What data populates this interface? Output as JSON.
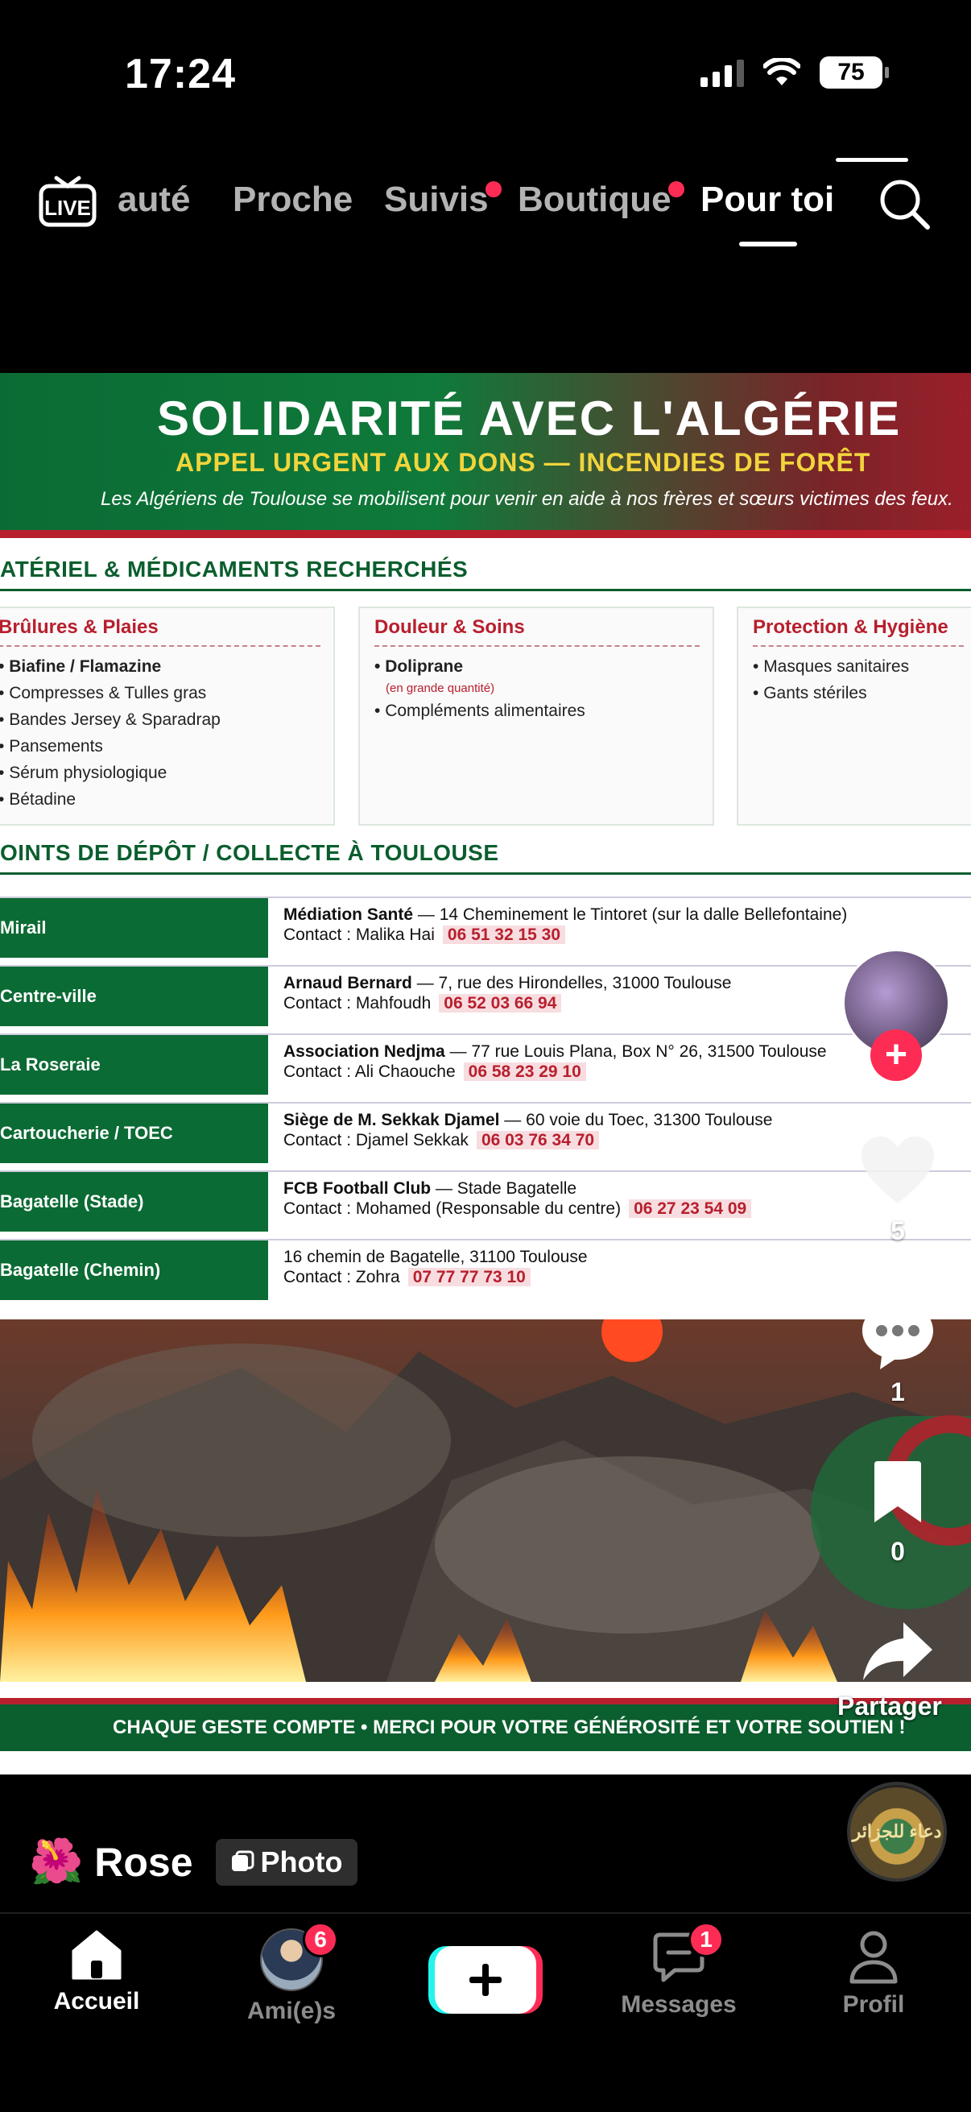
{
  "status_bar": {
    "time": "17:24",
    "battery": "75"
  },
  "top_nav": {
    "tabs": [
      {
        "label": "auté",
        "has_dot": false
      },
      {
        "label": "Proche",
        "has_dot": false
      },
      {
        "label": "Suivis",
        "has_dot": true
      },
      {
        "label": "Boutique",
        "has_dot": true
      },
      {
        "label": "Pour toi",
        "has_dot": false,
        "active": true
      }
    ],
    "live_label": "LIVE"
  },
  "poster": {
    "title": "SOLIDARITÉ AVEC L'ALGÉRIE",
    "subtitle": "APPEL URGENT AUX DONS — INCENDIES DE FORÊT",
    "intro": "Les Algériens de Toulouse se mobilisent pour venir en aide à nos frères et sœurs victimes des feux.",
    "materials_title": "ATÉRIEL & MÉDICAMENTS RECHERCHÉS",
    "categories": [
      {
        "title": "Brûlures & Plaies",
        "items": [
          "Biafine / Flamazine",
          "Compresses & Tulles gras",
          "Bandes Jersey & Sparadrap",
          "Pansements",
          "Sérum physiologique",
          "Bétadine"
        ]
      },
      {
        "title": "Douleur & Soins",
        "items": [
          "Doliprane",
          "(en grande quantité)",
          "Compléments alimentaires"
        ]
      },
      {
        "title": "Protection & Hygiène",
        "items": [
          "Masques sanitaires",
          "Gants stériles"
        ]
      }
    ],
    "points_title": "OINTS DE DÉPÔT / COLLECTE À TOULOUSE",
    "locations": [
      {
        "name": "Mirail",
        "org": "Médiation Santé",
        "address": " — 14 Cheminement le Tintoret (sur la dalle Bellefontaine)",
        "contact": "Contact : Malika Hai",
        "phone": "06 51 32 15 30"
      },
      {
        "name": "Centre-ville",
        "org": "Arnaud Bernard",
        "address": " — 7, rue des Hirondelles, 31000 Toulouse",
        "contact": "Contact : Mahfoudh",
        "phone": "06 52 03 66 94"
      },
      {
        "name": "La Roseraie",
        "org": "Association Nedjma",
        "address": " — 77 rue Louis Plana, Box N° 26, 31500 Toulouse",
        "contact": "Contact : Ali Chaouche",
        "phone": "06 58 23 29 10"
      },
      {
        "name": "Cartoucherie / TOEC",
        "org": "Siège de M. Sekkak Djamel",
        "address": " — 60 voie du Toec, 31300 Toulouse",
        "contact": "Contact : Djamel Sekkak",
        "phone": "06 03 76 34 70"
      },
      {
        "name": "Bagatelle (Stade)",
        "org": "FCB Football Club",
        "address": " — Stade Bagatelle",
        "contact": "Contact : Mohamed (Responsable du centre)",
        "phone": "06 27 23 54 09"
      },
      {
        "name": "Bagatelle (Chemin)",
        "org": "",
        "address": "16 chemin de Bagatelle, 31100 Toulouse",
        "contact": "Contact : Zohra",
        "phone": "07 77 77 73 10"
      }
    ],
    "footer": "CHAQUE GESTE COMPTE • MERCI POUR VOTRE GÉNÉROSITÉ ET VOTRE SOUTIEN !"
  },
  "right_rail": {
    "likes": "5",
    "comments": "1",
    "saves": "0",
    "share_label": "Partager",
    "music_disc_text": "دعاء للجزائر"
  },
  "caption": {
    "emoji": "🌺",
    "author": "Rose",
    "type_pill": "Photo"
  },
  "bottom_nav": {
    "items": [
      {
        "label": "Accueil",
        "active": true
      },
      {
        "label": "Ami(e)s",
        "badge": "6"
      },
      {
        "label": "",
        "create": true
      },
      {
        "label": "Messages",
        "badge": "1"
      },
      {
        "label": "Profil"
      }
    ]
  },
  "colors": {
    "accent": "#fe2c55",
    "poster_green": "#0b6b34",
    "poster_red": "#b81f2d",
    "poster_yellow": "#f2d53c"
  }
}
